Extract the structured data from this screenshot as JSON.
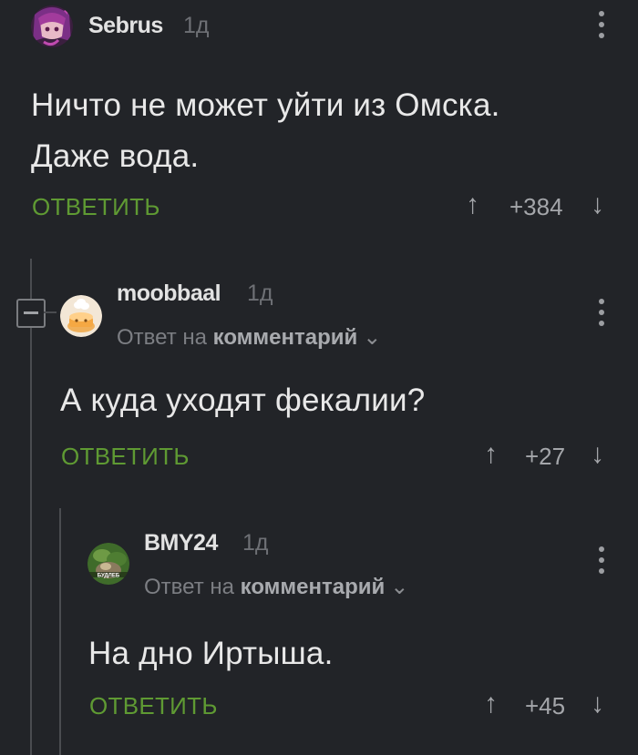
{
  "comments": [
    {
      "username": "Sebrus",
      "time": "1д",
      "text_line1": "Ничто не может уйти из Омска.",
      "text_line2": "Даже вода.",
      "reply_label": "ОТВЕТИТЬ",
      "score": "+384",
      "avatar_icon": "anime-girl-avatar"
    },
    {
      "username": "moobbaal",
      "time": "1д",
      "reply_to_prefix": "Ответ на",
      "reply_to_link": "комментарий",
      "text": "А куда уходят фекалии?",
      "reply_label": "ОТВЕТИТЬ",
      "score": "+27",
      "avatar_icon": "cartoon-cake-avatar"
    },
    {
      "username": "BMY24",
      "time": "1д",
      "reply_to_prefix": "Ответ на",
      "reply_to_link": "комментарий",
      "text": "На дно Иртыша.",
      "reply_label": "ОТВЕТИТЬ",
      "score": "+45",
      "avatar_icon": "nature-photo-avatar",
      "avatar_caption": "БУДЛЕБ"
    }
  ],
  "colors": {
    "background": "#222428",
    "accent_green": "#5f9a33",
    "muted_text": "#7c7e83",
    "thread_line": "#4a4c50"
  }
}
